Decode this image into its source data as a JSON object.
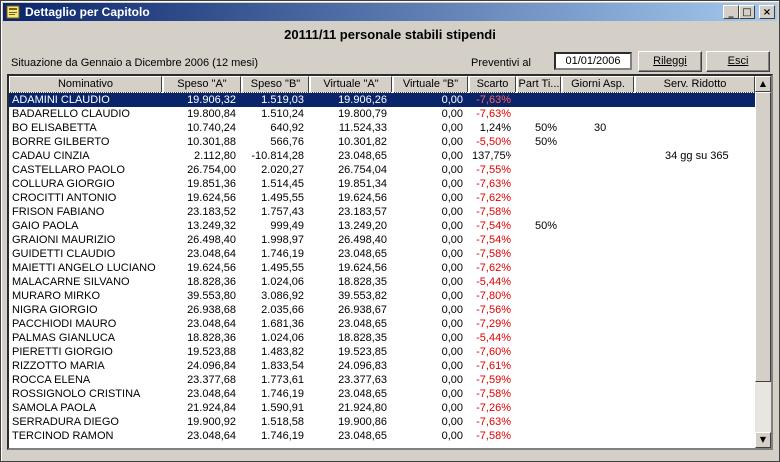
{
  "window": {
    "title": "Dettaglio per Capitolo",
    "min": "_",
    "max": "□",
    "close": "×"
  },
  "heading": "20111/11 personale stabili stipendi",
  "situazione": "Situazione da Gennaio a Dicembre 2006 (12 mesi)",
  "preventivi_label": "Preventivi al",
  "preventivi_date": "01/01/2006",
  "buttons": {
    "rileggi": "Rileggi",
    "esci": "Esci"
  },
  "columns": [
    "Nominativo",
    "Speso \"A\"",
    "Speso \"B\"",
    "Virtuale \"A\"",
    "Virtuale \"B\"",
    "Scarto",
    "Part Ti...",
    "Giorni Asp.",
    "Serv. Ridotto"
  ],
  "rows": [
    [
      "ADAMINI CLAUDIO",
      "19.906,32",
      "1.519,03",
      "19.906,26",
      "0,00",
      "-7,63%",
      "",
      "",
      ""
    ],
    [
      "BADARELLO CLAUDIO",
      "19.800,84",
      "1.510,24",
      "19.800,79",
      "0,00",
      "-7,63%",
      "",
      "",
      ""
    ],
    [
      "BO ELISABETTA",
      "10.740,24",
      "640,92",
      "11.524,33",
      "0,00",
      "1,24%",
      "50%",
      "30",
      ""
    ],
    [
      "BORRE GILBERTO",
      "10.301,88",
      "566,76",
      "10.301,82",
      "0,00",
      "-5,50%",
      "50%",
      "",
      ""
    ],
    [
      "CADAU CINZIA",
      "2.112,80",
      "-10.814,28",
      "23.048,65",
      "0,00",
      "137,75%",
      "",
      "",
      "34 gg su 365"
    ],
    [
      "CASTELLARO PAOLO",
      "26.754,00",
      "2.020,27",
      "26.754,04",
      "0,00",
      "-7,55%",
      "",
      "",
      ""
    ],
    [
      "COLLURA GIORGIO",
      "19.851,36",
      "1.514,45",
      "19.851,34",
      "0,00",
      "-7,63%",
      "",
      "",
      ""
    ],
    [
      "CROCITTI ANTONIO",
      "19.624,56",
      "1.495,55",
      "19.624,56",
      "0,00",
      "-7,62%",
      "",
      "",
      ""
    ],
    [
      "FRISON FABIANO",
      "23.183,52",
      "1.757,43",
      "23.183,57",
      "0,00",
      "-7,58%",
      "",
      "",
      ""
    ],
    [
      "GAIO PAOLA",
      "13.249,32",
      "999,49",
      "13.249,20",
      "0,00",
      "-7,54%",
      "50%",
      "",
      ""
    ],
    [
      "GRAIONI MAURIZIO",
      "26.498,40",
      "1.998,97",
      "26.498,40",
      "0,00",
      "-7,54%",
      "",
      "",
      ""
    ],
    [
      "GUIDETTI CLAUDIO",
      "23.048,64",
      "1.746,19",
      "23.048,65",
      "0,00",
      "-7,58%",
      "",
      "",
      ""
    ],
    [
      "MAIETTI ANGELO LUCIANO",
      "19.624,56",
      "1.495,55",
      "19.624,56",
      "0,00",
      "-7,62%",
      "",
      "",
      ""
    ],
    [
      "MALACARNE SILVANO",
      "18.828,36",
      "1.024,06",
      "18.828,35",
      "0,00",
      "-5,44%",
      "",
      "",
      ""
    ],
    [
      "MURARO MIRKO",
      "39.553,80",
      "3.086,92",
      "39.553,82",
      "0,00",
      "-7,80%",
      "",
      "",
      ""
    ],
    [
      "NIGRA GIORGIO",
      "26.938,68",
      "2.035,66",
      "26.938,67",
      "0,00",
      "-7,56%",
      "",
      "",
      ""
    ],
    [
      "PACCHIODI MAURO",
      "23.048,64",
      "1.681,36",
      "23.048,65",
      "0,00",
      "-7,29%",
      "",
      "",
      ""
    ],
    [
      "PALMAS GIANLUCA",
      "18.828,36",
      "1.024,06",
      "18.828,35",
      "0,00",
      "-5,44%",
      "",
      "",
      ""
    ],
    [
      "PIERETTI GIORGIO",
      "19.523,88",
      "1.483,82",
      "19.523,85",
      "0,00",
      "-7,60%",
      "",
      "",
      ""
    ],
    [
      "RIZZOTTO MARIA",
      "24.096,84",
      "1.833,54",
      "24.096,83",
      "0,00",
      "-7,61%",
      "",
      "",
      ""
    ],
    [
      "ROCCA ELENA",
      "23.377,68",
      "1.773,61",
      "23.377,63",
      "0,00",
      "-7,59%",
      "",
      "",
      ""
    ],
    [
      "ROSSIGNOLO CRISTINA",
      "23.048,64",
      "1.746,19",
      "23.048,65",
      "0,00",
      "-7,58%",
      "",
      "",
      ""
    ],
    [
      "SAMOLA PAOLA",
      "21.924,84",
      "1.590,91",
      "21.924,80",
      "0,00",
      "-7,26%",
      "",
      "",
      ""
    ],
    [
      "SERRADURA DIEGO",
      "19.900,92",
      "1.518,58",
      "19.900,86",
      "0,00",
      "-7,63%",
      "",
      "",
      ""
    ],
    [
      "TERCINOD RAMON",
      "23.048,64",
      "1.746,19",
      "23.048,65",
      "0,00",
      "-7,58%",
      "",
      "",
      ""
    ]
  ],
  "selected_row": 0,
  "colors": {
    "title_start": "#0a246a",
    "title_end": "#a6caf0",
    "selection": "#0a246a",
    "negative": "#e00000",
    "face": "#d4d0c8"
  },
  "icons": {
    "window": "app-icon",
    "scroll_up": "arrow-up-icon",
    "scroll_down": "arrow-down-icon"
  }
}
